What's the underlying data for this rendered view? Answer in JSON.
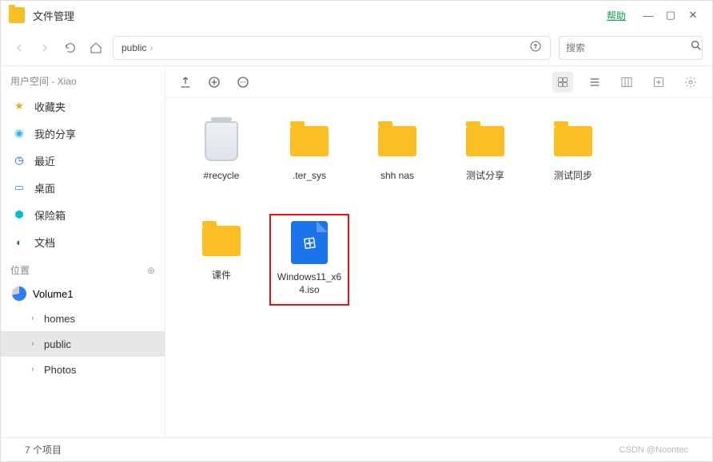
{
  "titlebar": {
    "app_title": "文件管理",
    "help_label": "帮助"
  },
  "navbar": {
    "breadcrumb": [
      "public"
    ],
    "search_placeholder": "搜索"
  },
  "sidebar": {
    "user_section_title": "用户空间 - Xiao",
    "favorites": [
      {
        "icon": "star",
        "label": "收藏夹",
        "color": "#f5a623"
      },
      {
        "icon": "share",
        "label": "我的分享",
        "color": "#29b6f6"
      },
      {
        "icon": "clock",
        "label": "最近",
        "color": "#1e4fd8"
      },
      {
        "icon": "desktop",
        "label": "桌面",
        "color": "#2196f3"
      },
      {
        "icon": "vault",
        "label": "保险箱",
        "color": "#00bcd4"
      },
      {
        "icon": "doc",
        "label": "文档",
        "color": "#1565c0"
      }
    ],
    "location_title": "位置",
    "volume_label": "Volume1",
    "tree": [
      {
        "label": "homes",
        "active": false
      },
      {
        "label": "public",
        "active": true
      },
      {
        "label": "Photos",
        "active": false
      }
    ]
  },
  "files": [
    {
      "type": "recycle",
      "label": "#recycle",
      "highlight": false
    },
    {
      "type": "folder",
      "label": ".ter_sys",
      "highlight": false
    },
    {
      "type": "folder",
      "label": "shh nas",
      "highlight": false
    },
    {
      "type": "folder",
      "label": "测试分享",
      "highlight": false
    },
    {
      "type": "folder",
      "label": "测试同步",
      "highlight": false
    },
    {
      "type": "folder",
      "label": "课件",
      "highlight": false
    },
    {
      "type": "iso",
      "label": "Windows11_x64.iso",
      "highlight": true
    }
  ],
  "statusbar": {
    "item_count_text": "7 个项目",
    "watermark": "CSDN @Noontec"
  }
}
